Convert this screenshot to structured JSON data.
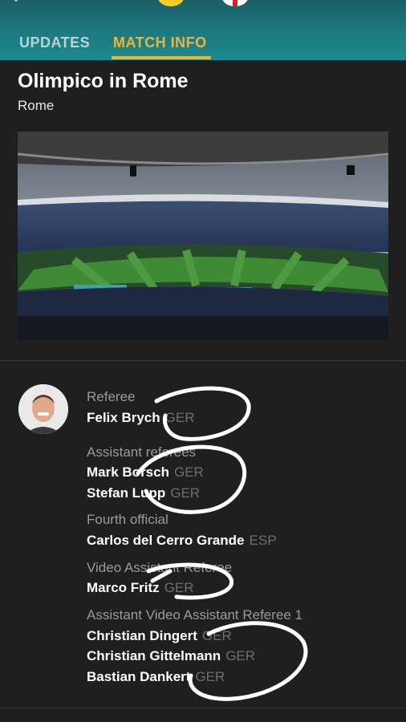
{
  "tabs": {
    "updates": "UPDATES",
    "match_info": "MATCH INFO"
  },
  "venue": {
    "name": "Olimpico in Rome",
    "city": "Rome"
  },
  "officials": [
    {
      "role": "Referee",
      "people": [
        {
          "name": "Felix Brych",
          "nation": "GER"
        }
      ]
    },
    {
      "role": "Assistant referees",
      "people": [
        {
          "name": "Mark Borsch",
          "nation": "GER"
        },
        {
          "name": "Stefan Lupp",
          "nation": "GER"
        }
      ]
    },
    {
      "role": "Fourth official",
      "people": [
        {
          "name": "Carlos del Cerro Grande",
          "nation": "ESP"
        }
      ]
    },
    {
      "role": "Video Assistant Referee",
      "people": [
        {
          "name": "Marco Fritz",
          "nation": "GER"
        }
      ]
    },
    {
      "role": "Assistant Video Assistant Referee 1",
      "people": [
        {
          "name": "Christian Dingert",
          "nation": "GER"
        },
        {
          "name": "Christian Gittelmann",
          "nation": "GER"
        },
        {
          "name": "Bastian Dankert",
          "nation": "GER"
        }
      ]
    }
  ],
  "colors": {
    "header": "#1d7a80",
    "accent": "#f1b23a",
    "background": "#1f1f1f"
  }
}
